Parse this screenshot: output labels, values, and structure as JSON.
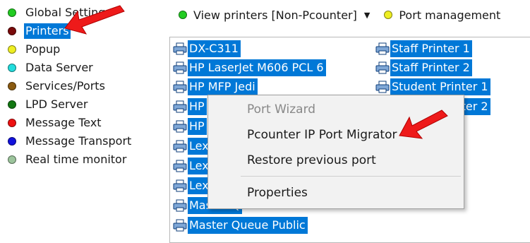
{
  "sidebar": {
    "items": [
      {
        "label": "Global Settings",
        "color": "#22cc22",
        "selected": false
      },
      {
        "label": "Printers",
        "color": "#7a0a0a",
        "selected": true
      },
      {
        "label": "Popup",
        "color": "#eeee22",
        "selected": false
      },
      {
        "label": "Data Server",
        "color": "#22dddd",
        "selected": false
      },
      {
        "label": "Services/Ports",
        "color": "#8a5a10",
        "selected": false
      },
      {
        "label": "LPD Server",
        "color": "#117711",
        "selected": false
      },
      {
        "label": "Message Text",
        "color": "#ee1111",
        "selected": false
      },
      {
        "label": "Message Transport",
        "color": "#1111dd",
        "selected": false
      },
      {
        "label": "Real time monitor",
        "color": "#9cc49c",
        "selected": false
      }
    ]
  },
  "toolbar": {
    "view_label": "View printers [Non-Pcounter]",
    "view_color": "#22cc22",
    "port_label": "Port management",
    "port_color": "#eeee22"
  },
  "printers": {
    "column1": [
      "DX-C311",
      "HP LaserJet M606 PCL 6",
      "HP MFP Jedi",
      "HP",
      "HP",
      "Lex",
      "Lex",
      "Lex",
      "Master Q",
      "Master Queue Public"
    ],
    "column2": [
      "Staff Printer 1",
      "Staff Printer 2",
      "Student Printer 1",
      "Student Printer 2"
    ]
  },
  "context_menu": {
    "items": [
      {
        "label": "Port Wizard",
        "enabled": false
      },
      {
        "label": "Pcounter IP Port Migrator",
        "enabled": true
      },
      {
        "label": "Restore previous port",
        "enabled": true
      },
      {
        "label": "Properties",
        "enabled": true
      }
    ]
  },
  "colors": {
    "selection": "#0078d7",
    "annotation_arrow": "#ee1a1a"
  }
}
